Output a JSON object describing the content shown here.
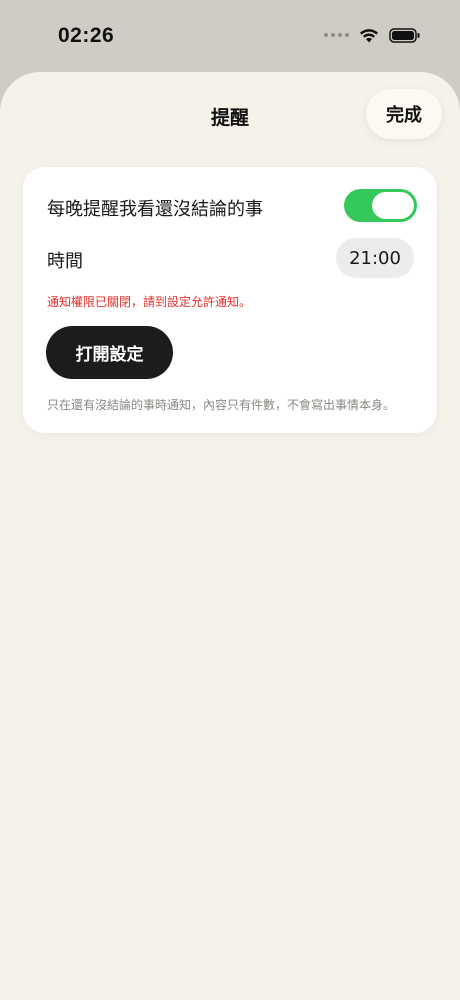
{
  "status_bar": {
    "time": "02:26"
  },
  "header": {
    "title": "提醒",
    "done_label": "完成"
  },
  "reminder_card": {
    "nightly_label": "每晚提醒我看還沒結論的事",
    "nightly_enabled": true,
    "time_label": "時間",
    "time_value": "21:00",
    "warning_text": "通知權限已關閉，請到設定允許通知。",
    "open_settings_label": "打開設定",
    "footnote": "只在還有沒結論的事時通知，內容只有件數，不會寫出事情本身。"
  },
  "colors": {
    "toggle_on": "#34c759",
    "warning": "#e5312d",
    "sheet_background": "#f5f2ea",
    "backdrop": "#cfccc5"
  },
  "icons": [
    "signal-icon",
    "wifi-icon",
    "battery-icon"
  ]
}
